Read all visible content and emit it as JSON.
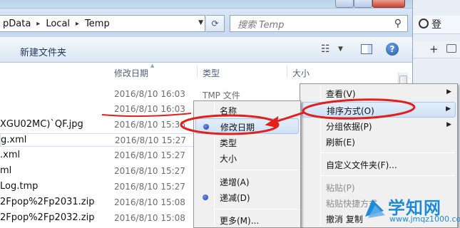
{
  "address": {
    "crumbs": [
      "pData",
      "Local",
      "Temp"
    ],
    "separator": "▸"
  },
  "search": {
    "placeholder": "搜索 Temp"
  },
  "toolbar": {
    "new_folder": "新建文件夹"
  },
  "columns": {
    "date": "修改日期",
    "type": "类型",
    "size": "大小"
  },
  "files": [
    {
      "name": "",
      "date": "2016/8/10 16:03",
      "type": "TMP 文件"
    },
    {
      "name": "",
      "date": "2016/8/10 16:03",
      "type": ""
    },
    {
      "name": "XGU02MC)`QF.jpg",
      "date": "2016/8/10 15:36",
      "type": ""
    },
    {
      "name": "g.xml",
      "date": "2016/8/10 15:27",
      "type": ""
    },
    {
      "name": ".xml",
      "date": "2016/8/10 15:27",
      "type": ""
    },
    {
      "name": "ml",
      "date": "2016/8/10 15:27",
      "type": ""
    },
    {
      "name": "Log.tmp",
      "date": "2016/8/10 15:27",
      "type": ""
    },
    {
      "name": "2Fpop%2Fp2031.zip",
      "date": "2016/8/10 15:08",
      "type": ""
    },
    {
      "name": "2Fpop%2Fp2032.zip",
      "date": "2016/8/10 15:08",
      "type": ""
    }
  ],
  "context_menu": {
    "items": [
      {
        "label": "查看(V)",
        "arrow": "▶"
      },
      {
        "label": "排序方式(O)",
        "arrow": "▶"
      },
      {
        "label": "分组依据(P)",
        "arrow": "▶"
      },
      {
        "label": "刷新(E)"
      },
      {
        "label": "自定义文件夹(F)..."
      },
      {
        "label": "粘贴(P)"
      },
      {
        "label": "粘贴快捷方式"
      },
      {
        "label": "撤消 复制"
      }
    ]
  },
  "sort_menu": {
    "items": [
      {
        "label": "名称"
      },
      {
        "label": "修改日期"
      },
      {
        "label": "类型"
      },
      {
        "label": "大小"
      },
      {
        "label": "递增(A)"
      },
      {
        "label": "递减(D)"
      },
      {
        "label": "更多(M)..."
      }
    ]
  },
  "right_window": {
    "text": "登",
    "tab_plus": "+"
  },
  "watermark": {
    "title": "学知网",
    "url": "www.jmqz1000.com"
  },
  "colors": {
    "annotation": "#e0201c",
    "watermark": "#1c8ad6"
  }
}
